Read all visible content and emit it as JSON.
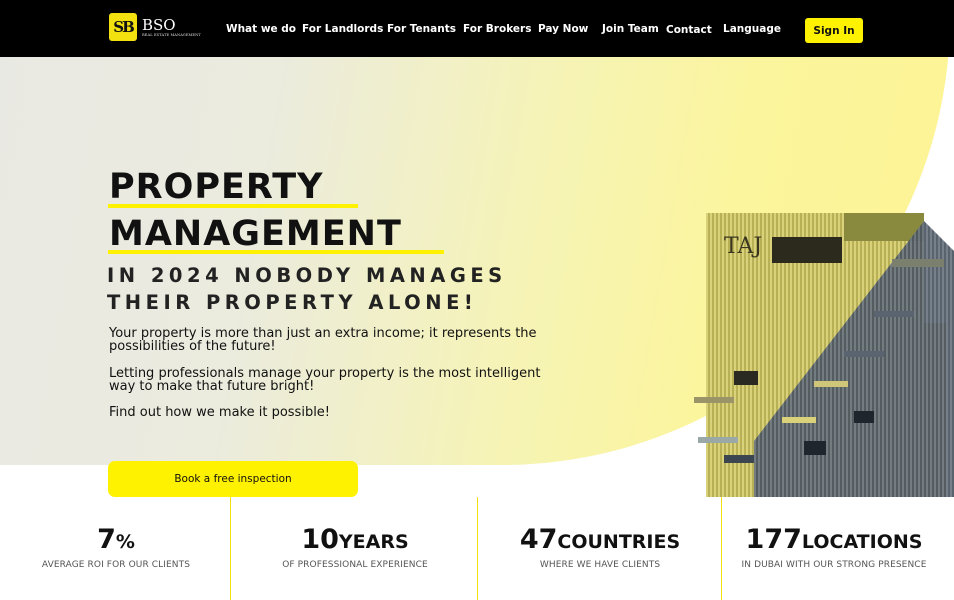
{
  "brand": {
    "mark": "SB",
    "name": "BSO",
    "tagline": "REAL ESTATE MANAGEMENT"
  },
  "nav": {
    "items": [
      "What we do",
      "For Landlords",
      "For Tenants",
      "For Brokers",
      "Pay Now",
      "Join Team",
      "Contact",
      "Language"
    ],
    "sign_in": "Sign In"
  },
  "hero": {
    "title_line1": "PROPERTY",
    "title_line2": "MANAGEMENT",
    "subtitle_line1": "IN 2024 NOBODY MANAGES",
    "subtitle_line2": "THEIR PROPERTY ALONE!",
    "paragraph1": "Your property is more than just an extra income; it represents the possibilities of the future!",
    "paragraph2": "Letting professionals manage your property is the most intelligent way to make that future bright!",
    "paragraph3": "Find out how we make it possible!",
    "cta": "Book a free inspection"
  },
  "stats": [
    {
      "value": "7",
      "unit": "%",
      "label": "AVERAGE ROI FOR OUR CLIENTS"
    },
    {
      "value": "10",
      "unit": "YEARS",
      "label": "OF PROFESSIONAL EXPERIENCE"
    },
    {
      "value": "47",
      "unit": "COUNTRIES",
      "label": "WHERE WE HAVE CLIENTS"
    },
    {
      "value": "177",
      "unit": "LOCATIONS",
      "label": "IN DUBAI WITH OUR STRONG PRESENCE"
    }
  ],
  "colors": {
    "accent": "#fff200",
    "topbar": "#000000"
  },
  "icons": {
    "logo": "bso-logo-icon"
  }
}
